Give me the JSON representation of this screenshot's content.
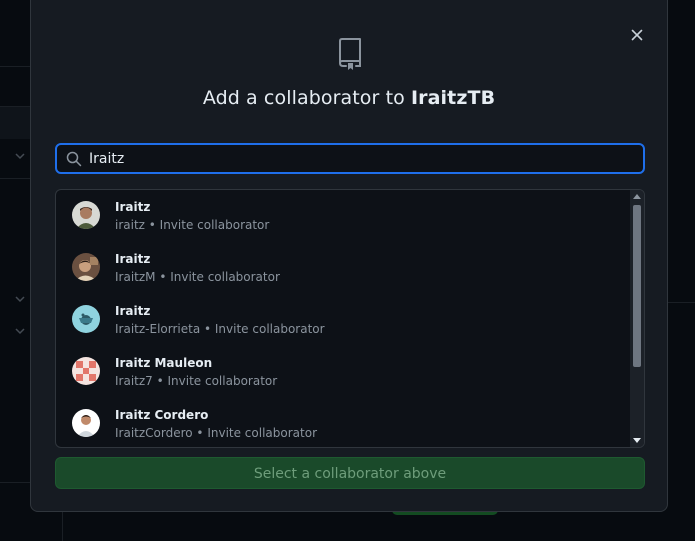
{
  "dialog": {
    "title_prefix": "Add a collaborator to ",
    "title_repo": "IraitzTB",
    "close_icon": "close-icon",
    "repo_icon": "repo-icon"
  },
  "search": {
    "value": "Iraitz",
    "icon": "search-icon"
  },
  "results": [
    {
      "name": "Iraitz",
      "subtitle": "iraitz • Invite collaborator"
    },
    {
      "name": "Iraitz",
      "subtitle": "IraitzM • Invite collaborator"
    },
    {
      "name": "Iraitz",
      "subtitle": "Iraitz-Elorrieta • Invite collaborator"
    },
    {
      "name": "Iraitz Mauleon",
      "subtitle": "Iraitz7 • Invite collaborator"
    },
    {
      "name": "Iraitz Cordero",
      "subtitle": "IraitzCordero • Invite collaborator"
    }
  ],
  "submit_label": "Select a collaborator above",
  "colors": {
    "accent_blue": "#1f6feb",
    "dialog_bg": "#161b22",
    "button_green_disabled": "#1a4a2a"
  }
}
